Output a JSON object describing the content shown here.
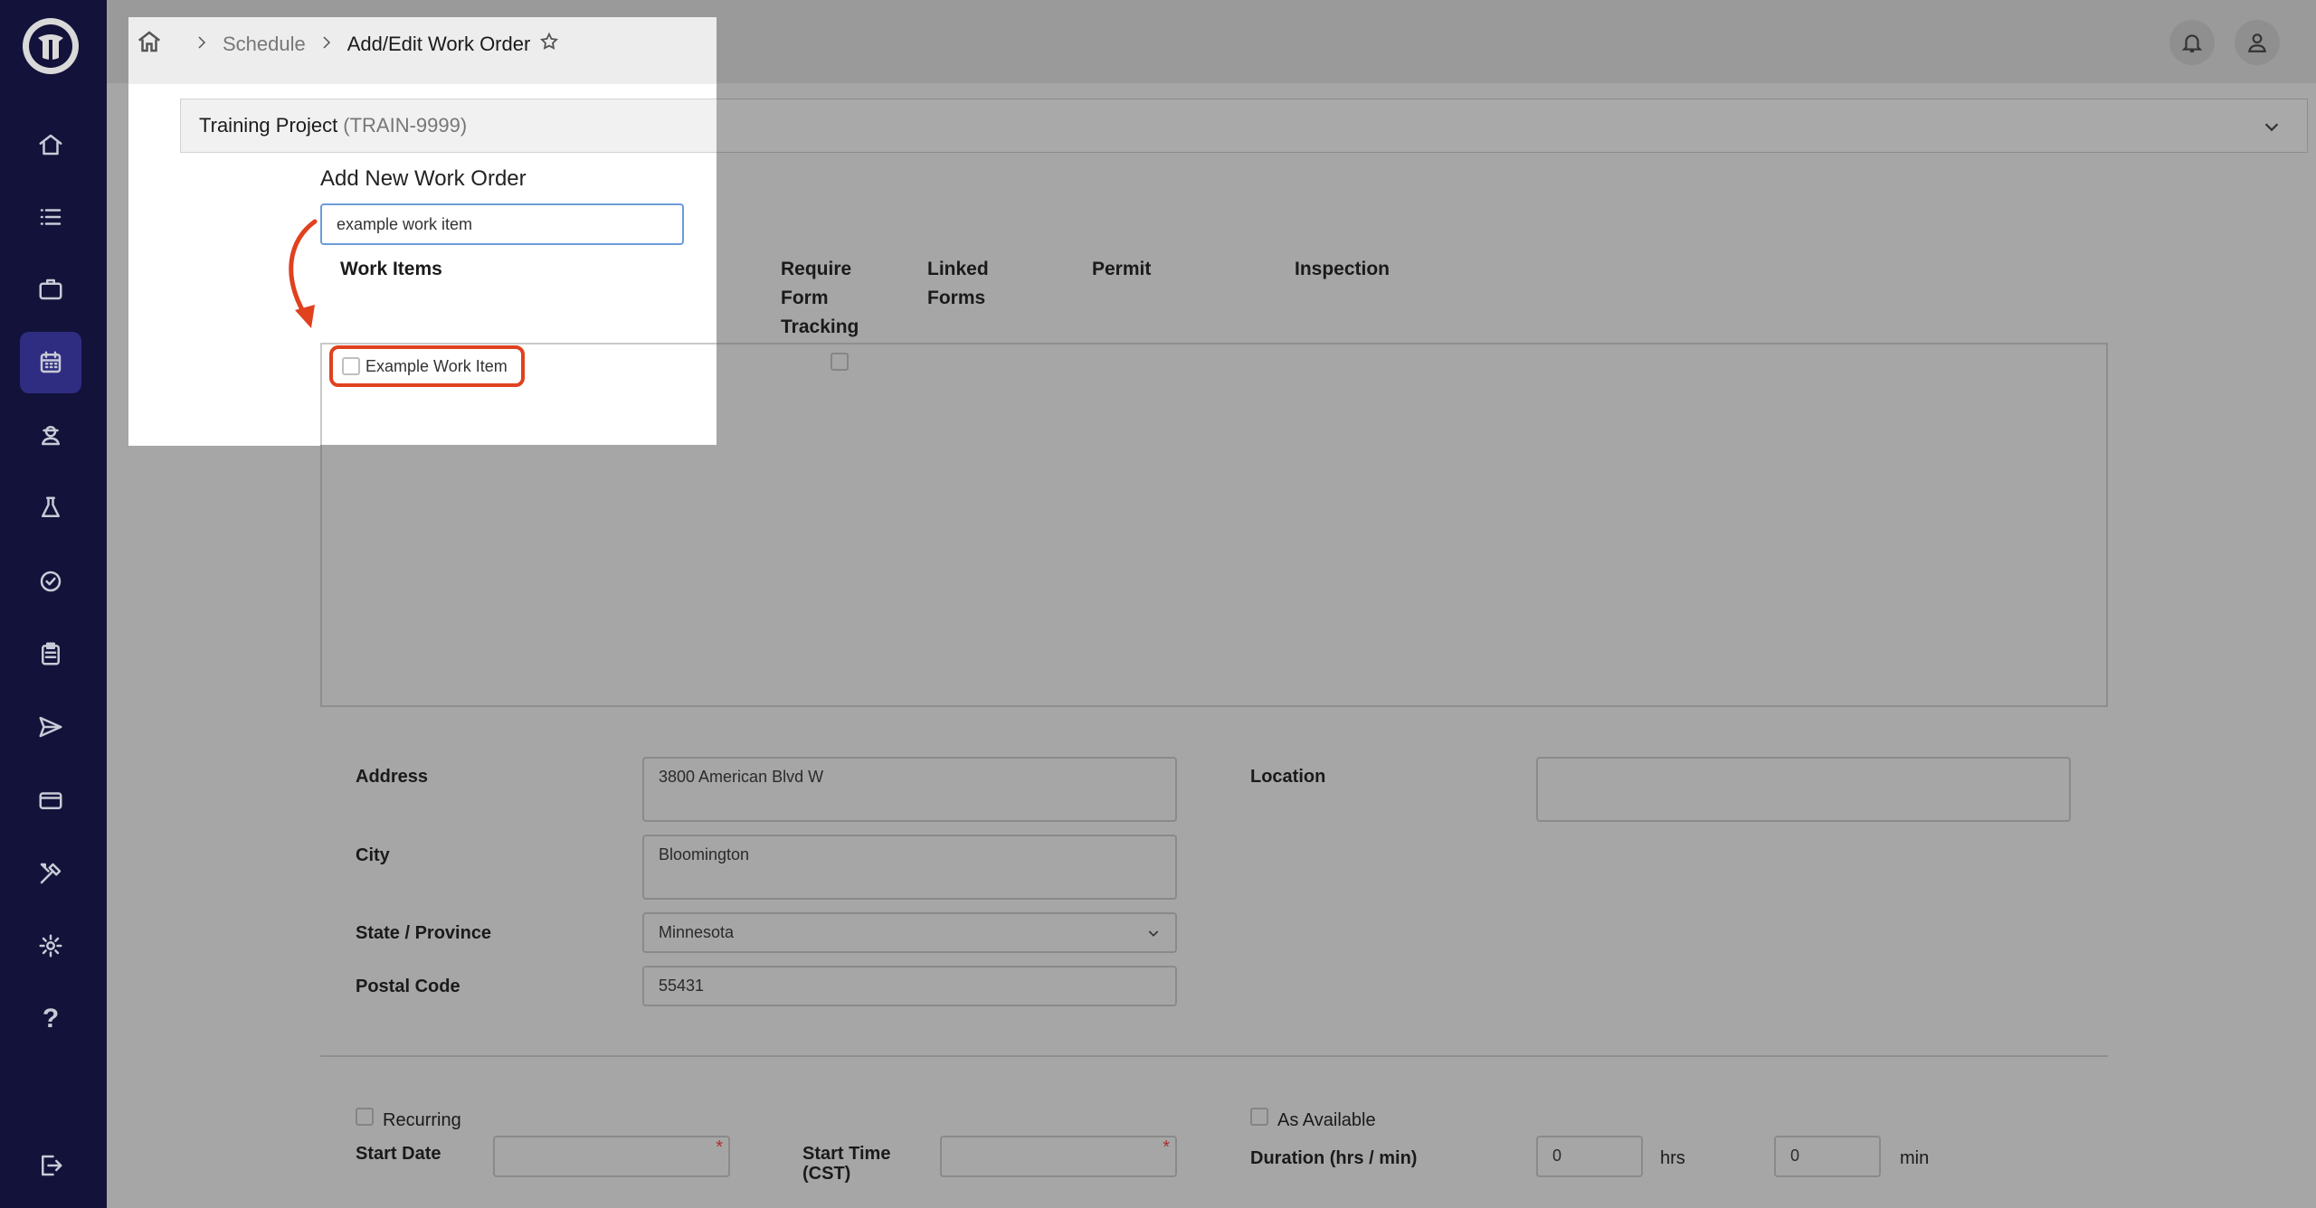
{
  "breadcrumb": {
    "items": [
      {
        "label": "Schedule"
      },
      {
        "label": "Add/Edit Work Order"
      }
    ]
  },
  "project": {
    "name": "Training Project",
    "code": "(TRAIN-9999)"
  },
  "form": {
    "title": "Add New Work Order",
    "search_value": "example work item",
    "headers": {
      "work_items": "Work Items",
      "require_1": "Require",
      "require_2": "Form",
      "require_3": "Tracking",
      "linked_1": "Linked",
      "linked_2": "Forms",
      "permit": "Permit",
      "inspection": "Inspection"
    },
    "work_item": {
      "label": "Example Work Item"
    },
    "address": {
      "label": "Address",
      "value": "3800 American Blvd W"
    },
    "city": {
      "label": "City",
      "value": "Bloomington"
    },
    "state": {
      "label": "State / Province",
      "value": "Minnesota"
    },
    "postal": {
      "label": "Postal Code",
      "value": "55431"
    },
    "location": {
      "label": "Location",
      "value": ""
    },
    "recurring": {
      "label": "Recurring"
    },
    "start_date": {
      "label": "Start Date"
    },
    "start_time": {
      "label_1": "Start Time",
      "label_2": "(CST)"
    },
    "as_available": {
      "label": "As Available"
    },
    "duration": {
      "label": "Duration (hrs / min)",
      "hrs": "0",
      "hrs_unit": "hrs",
      "min": "0",
      "min_unit": "min"
    }
  },
  "colors": {
    "sidebar": "#13123a",
    "active": "#2f2d82",
    "highlight": "#e0411f"
  }
}
